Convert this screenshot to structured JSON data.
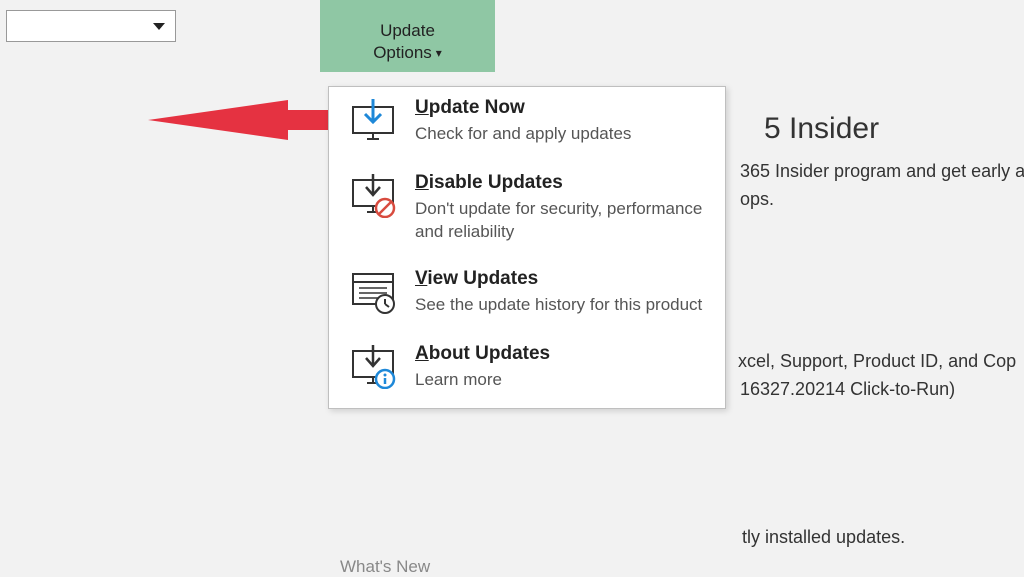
{
  "updateButton": {
    "line1": "Update",
    "line2": "Options"
  },
  "menu": {
    "items": [
      {
        "title": "Update Now",
        "desc": "Check for and apply updates"
      },
      {
        "title": "Disable Updates",
        "desc": "Don't update for security, performance and reliability"
      },
      {
        "title": "View Updates",
        "desc": "See the update history for this product"
      },
      {
        "title": "About Updates",
        "desc": "Learn more"
      }
    ]
  },
  "whatsNew": "What's New",
  "bg": {
    "insiderHeading": "5 Insider",
    "insiderLine1": "365 Insider program and get early a",
    "insiderLine2": "ops.",
    "line3": "xcel, Support, Product ID, and Cop",
    "line4": "16327.20214 Click-to-Run)",
    "line5": "tly installed updates."
  }
}
